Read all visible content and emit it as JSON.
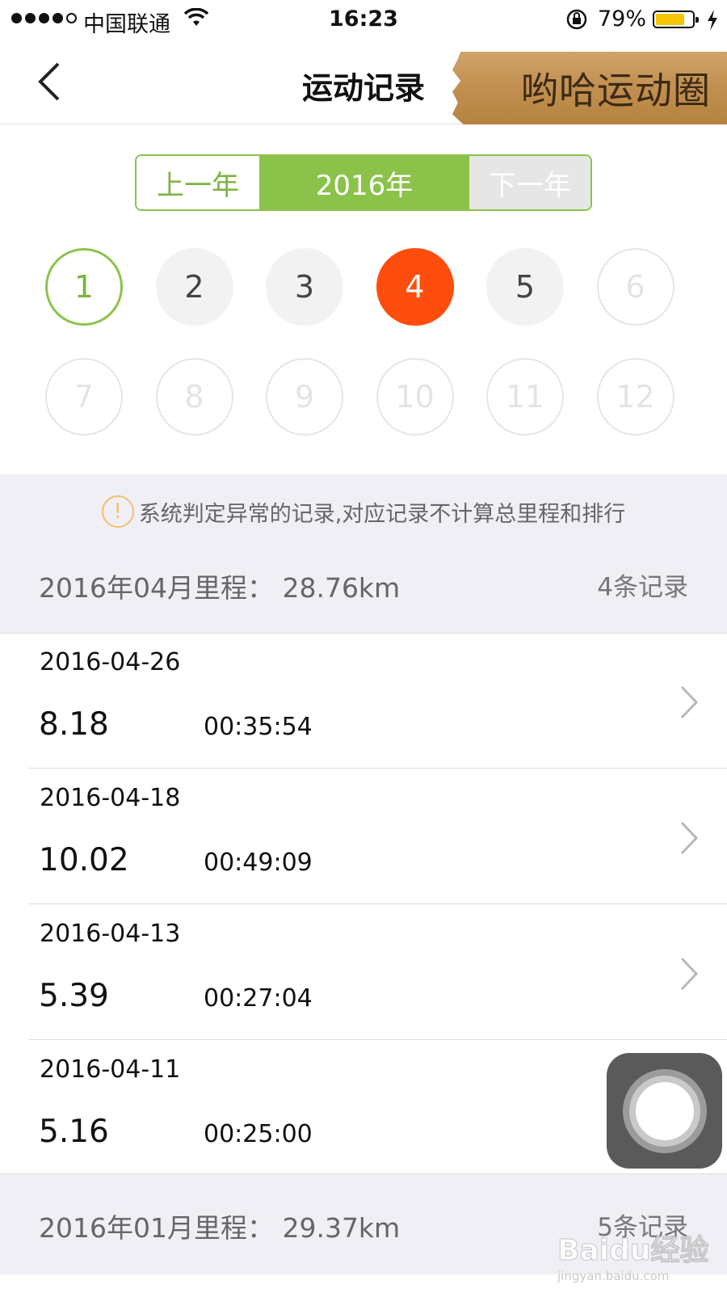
{
  "status_bar": {
    "carrier": "中国联通",
    "time": "16:23",
    "battery_percent": "79%",
    "battery_level": 0.79,
    "battery_color": "#f5c500"
  },
  "nav": {
    "title": "运动记录",
    "back_icon": "chevron-left-icon",
    "brand": "哟哈运动圈"
  },
  "year_selector": {
    "prev_label": "上一年",
    "current_label": "2016年",
    "next_label": "下一年",
    "accent_color": "#8bc34a"
  },
  "months": [
    {
      "label": "1",
      "state": "selected-outline"
    },
    {
      "label": "2",
      "state": "available"
    },
    {
      "label": "3",
      "state": "available"
    },
    {
      "label": "4",
      "state": "active"
    },
    {
      "label": "5",
      "state": "available"
    },
    {
      "label": "6",
      "state": "disabled"
    },
    {
      "label": "7",
      "state": "disabled"
    },
    {
      "label": "8",
      "state": "disabled"
    },
    {
      "label": "9",
      "state": "disabled"
    },
    {
      "label": "10",
      "state": "disabled"
    },
    {
      "label": "11",
      "state": "disabled"
    },
    {
      "label": "12",
      "state": "disabled"
    }
  ],
  "colors": {
    "active_month": "#ff4d0d",
    "outline_month": "#8bc34a",
    "warning": "#f0c070"
  },
  "notice": {
    "icon": "warning-icon",
    "text": "系统判定异常的记录,对应记录不计算总里程和排行"
  },
  "month_summary": {
    "label": "2016年04月里程：  28.76km",
    "count": "4条记录"
  },
  "records": [
    {
      "date": "2016-04-26",
      "distance": "8.18",
      "duration": "00:35:54",
      "has_chevron": true
    },
    {
      "date": "2016-04-18",
      "distance": "10.02",
      "duration": "00:49:09",
      "has_chevron": true
    },
    {
      "date": "2016-04-13",
      "distance": "5.39",
      "duration": "00:27:04",
      "has_chevron": true
    },
    {
      "date": "2016-04-11",
      "distance": "5.16",
      "duration": "00:25:00",
      "has_chevron": false
    }
  ],
  "month_summary_2": {
    "label": "2016年01月里程：  29.37km",
    "count": "5条记录"
  },
  "watermark": {
    "big": "Baidu经验",
    "small": "jingyan.baidu.com"
  }
}
